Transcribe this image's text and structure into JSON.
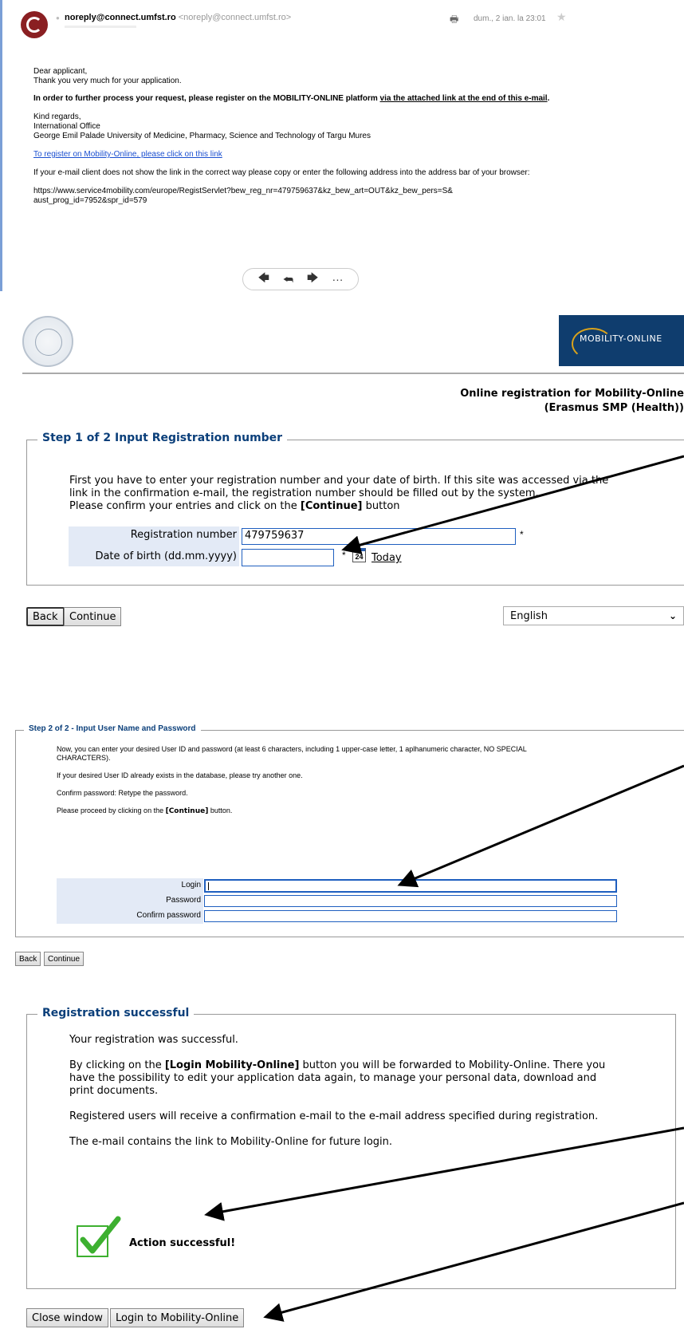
{
  "email": {
    "sender_name": "noreply@connect.umfst.ro",
    "sender_address": "<noreply@connect.umfst.ro>",
    "date": "dum., 2 ian. la 23:01",
    "greeting": "Dear applicant,",
    "thanks": "Thank you very much for your application.",
    "instruction_bold": "In order to further process your request, please register on the MOBILITY-ONLINE platform ",
    "instruction_link": "via the attached link at the end of this e-mail",
    "instruction_end": ".",
    "regards": "Kind regards,",
    "office": "International Office",
    "university": "George Emil Palade University of Medicine, Pharmacy, Science and Technology of Targu Mures",
    "register_link": "To register on Mobility-Online, please click on this link",
    "fallback_note": "If your e-mail client does not show the link in the correct way please copy or enter the following address into the address bar of your browser:",
    "url_line1": "https://www.service4mobility.com/europe/RegistServlet?bew_reg_nr=479759637&kz_bew_art=OUT&kz_bew_pers=S&",
    "url_line2": "aust_prog_id=7952&spr_id=579"
  },
  "header": {
    "logo_text": "MOBILITY-ONLINE",
    "title_line1": "Online registration for Mobility-Online",
    "title_line2": "(Erasmus SMP (Health))"
  },
  "step1": {
    "legend": "Step 1 of 2 Input Registration number",
    "intro1": "First you have to enter your registration number and your date of birth. If this site was accessed via the",
    "intro2": "link in the confirmation e-mail, the registration number should be filled out by the system.",
    "intro3_pre": "Please confirm your entries and click on the ",
    "intro3_bold": "[Continue]",
    "intro3_post": " button",
    "reg_label": "Registration number",
    "reg_value": "479759637",
    "dob_label": "Date of birth (dd.mm.yyyy)",
    "dob_value": "",
    "required_mark": "*",
    "calendar_day": "24",
    "today_link": "Today",
    "back_button": "Back",
    "continue_button": "Continue",
    "language": "English"
  },
  "step2": {
    "legend": "Step 2 of 2 - Input User Name and Password",
    "p1a": "Now, you can enter your desired User ID and password (at least 6 characters, including 1 upper-case letter, 1 aplhanumeric character, NO SPECIAL",
    "p1b": "CHARACTERS).",
    "p2": "If your desired User ID already exists in the database, please try another one.",
    "p3": "Confirm password: Retype the password.",
    "p4_pre": "Please proceed by clicking on the ",
    "p4_bold": "[Continue]",
    "p4_post": " button.",
    "login_label": "Login",
    "password_label": "Password",
    "confirm_label": "Confirm password",
    "back_button": "Back",
    "continue_button": "Continue"
  },
  "success": {
    "legend": "Registration successful",
    "p1": "Your registration was successful.",
    "p2_pre": "By clicking on the ",
    "p2_bold": "[Login Mobility-Online]",
    "p2_post": " button you will be forwarded to Mobility-Online. There you",
    "p2b": "have the possibility to edit your application data again, to manage your personal data, download and",
    "p2c": "print documents.",
    "p3": "Registered users will receive a confirmation e-mail to the e-mail address specified during registration.",
    "p4": "The e-mail contains the link to Mobility-Online for future login.",
    "action": "Action successful!",
    "close_button": "Close window",
    "login_button": "Login to Mobility-Online"
  },
  "colors": {
    "legend": "#0b3f7a",
    "link": "#1a4fd0",
    "form_bg": "#e3eaf6",
    "check_green": "#3db030",
    "logo_bg": "#0f3d6e"
  }
}
